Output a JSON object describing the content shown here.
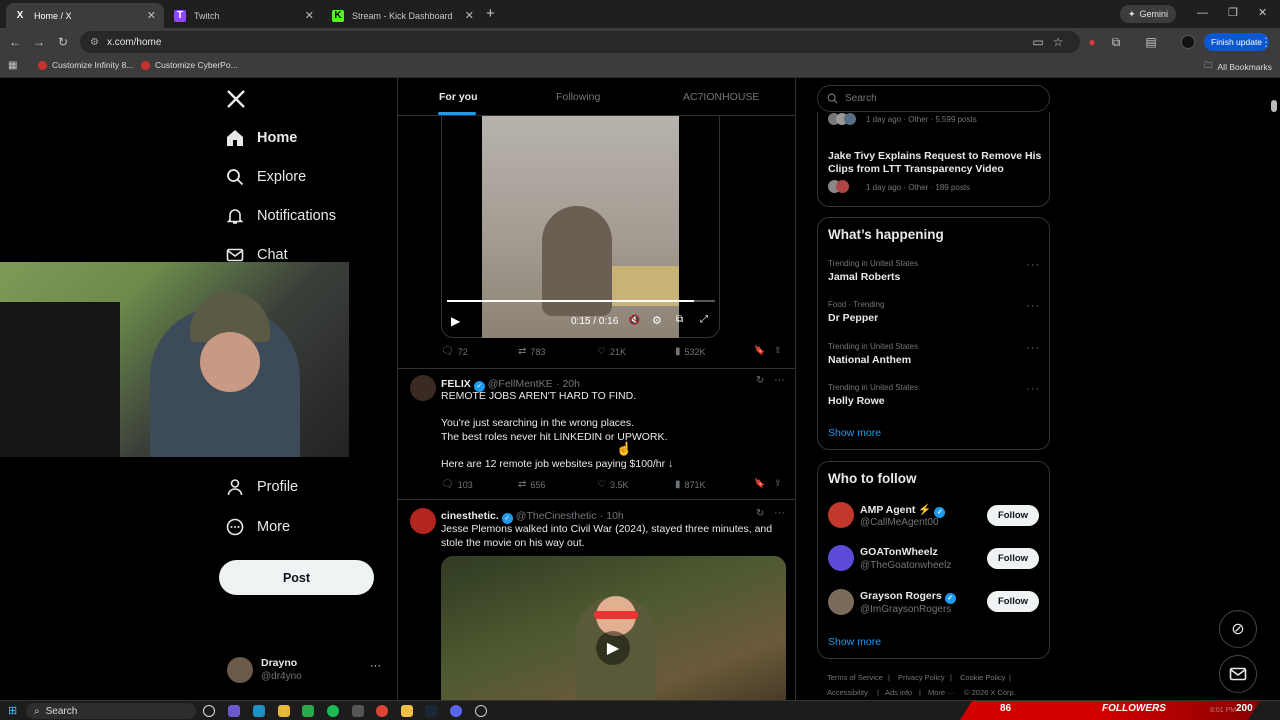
{
  "browser": {
    "tabs": [
      {
        "icon": "X",
        "title": "Home / X"
      },
      {
        "icon": "T",
        "title": "Twitch"
      },
      {
        "icon": "K",
        "title": "Stream - Kick Dashboard"
      }
    ],
    "new_tab": "+",
    "gemini_label": "Gemini",
    "url": "x.com/home",
    "finish_update": "Finish update",
    "bookmarks": [
      "Customize Infinity 8...",
      "Customize CyberPo..."
    ],
    "all_bookmarks": "All Bookmarks"
  },
  "nav": {
    "logo": "X",
    "items": [
      {
        "label": "Home",
        "icon": "home-icon"
      },
      {
        "label": "Explore",
        "icon": "search-icon"
      },
      {
        "label": "Notifications",
        "icon": "bell-icon"
      },
      {
        "label": "Chat",
        "icon": "mail-icon"
      },
      {
        "label": "Profile",
        "icon": "person-icon"
      },
      {
        "label": "More",
        "icon": "more-circle-icon"
      }
    ],
    "post_label": "Post",
    "account": {
      "name": "Drayno",
      "handle": "@dr4yno"
    }
  },
  "feed": {
    "tabs": [
      "For you",
      "Following",
      "AC7IONHOUSE"
    ],
    "video": {
      "time": "0:15 / 0:16",
      "progress": 0.92
    },
    "post1_stats": {
      "replies": "72",
      "reposts": "783",
      "likes": "21K",
      "views": "532K"
    },
    "post2": {
      "name": "FELIX",
      "handle": "@FellMentKE",
      "time": "· 20h",
      "lines": [
        "REMOTE JOBS AREN'T HARD TO FIND.",
        "",
        "You're just searching in the wrong places.",
        "The best roles never hit LINKEDIN or UPWORK.",
        "",
        "Here are 12 remote job websites paying $100/hr ↓"
      ],
      "stats": {
        "replies": "103",
        "reposts": "656",
        "likes": "3.5K",
        "views": "871K"
      }
    },
    "post3": {
      "name": "cinesthetic.",
      "handle": "@TheCinesthetic",
      "time": "· 10h",
      "lines": [
        "Jesse Plemons walked into Civil War (2024), stayed three minutes, and",
        "stole the movie on his way out."
      ]
    }
  },
  "right": {
    "search_placeholder": "Search",
    "news_top_meta": "1 day ago · Other · 5,599 posts",
    "news_title": [
      "Jake Tivy Explains Request to Remove His",
      "Clips from LTT Transparency Video"
    ],
    "news_meta": "1 day ago · Other · 189 posts",
    "happening_title": "What’s happening",
    "trends": [
      {
        "meta": "Trending in United States",
        "title": "Jamal Roberts"
      },
      {
        "meta": "Food · Trending",
        "title": "Dr Pepper"
      },
      {
        "meta": "Trending in United States",
        "title": "National Anthem"
      },
      {
        "meta": "Trending in United States",
        "title": "Holly Rowe"
      }
    ],
    "show_more": "Show more",
    "who_title": "Who to follow",
    "follows": [
      {
        "name": "AMP Agent ⚡",
        "handle": "@CallMeAgent00",
        "button": "Follow"
      },
      {
        "name": "GOATonWheelz",
        "handle": "@TheGoatonwheelz",
        "button": "Follow"
      },
      {
        "name": "Grayson Rogers",
        "handle": "@ImGraysonRogers",
        "button": "Follow"
      }
    ],
    "footer": [
      "Terms of Service",
      "|",
      "Privacy Policy",
      "|",
      "Cookie Policy",
      "|"
    ],
    "footer2": [
      "Accessibility",
      "|",
      "Ads info",
      "|",
      "More ···",
      "© 2026 X Corp."
    ]
  },
  "overlay": {
    "followers_count": "86",
    "followers_label": "FOLLOWERS",
    "goal": "200"
  },
  "taskbar": {
    "search": "Search",
    "time": "8:01 PM"
  },
  "colors": {
    "accent": "#1d9bf0",
    "chrome_bg": "#3c3c3c",
    "finish_update": "#0b57d0"
  }
}
